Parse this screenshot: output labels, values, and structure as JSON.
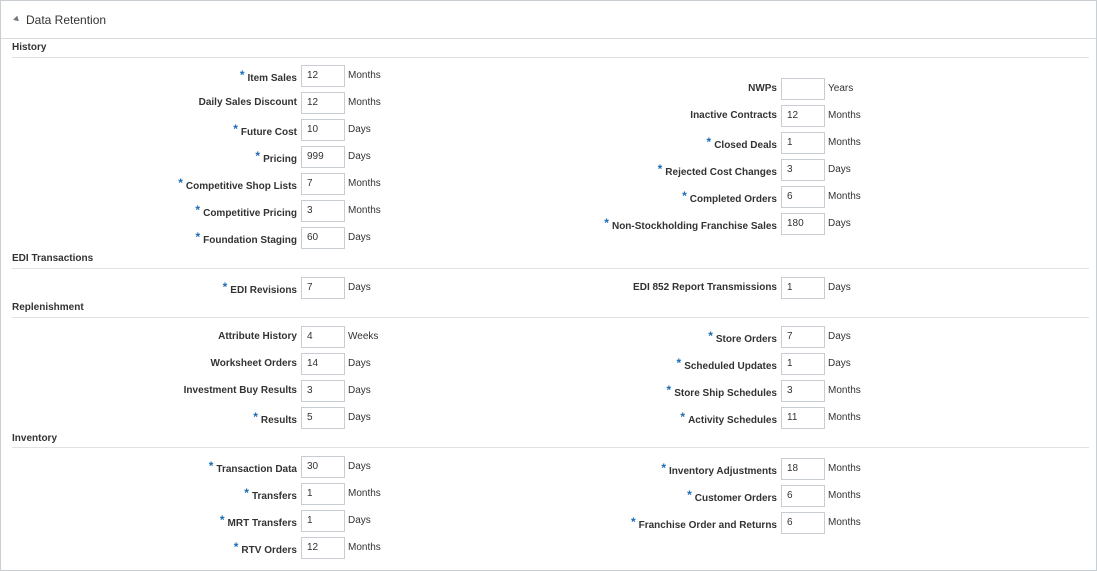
{
  "panel": {
    "title": "Data Retention"
  },
  "sections": {
    "history": "History",
    "edi": "EDI Transactions",
    "replenishment": "Replenishment",
    "inventory": "Inventory"
  },
  "fields": {
    "item_sales": {
      "label": "Item Sales",
      "required": true,
      "value": "12",
      "unit": "Months"
    },
    "daily_sales_discount": {
      "label": "Daily Sales Discount",
      "required": false,
      "value": "12",
      "unit": "Months"
    },
    "future_cost": {
      "label": "Future Cost",
      "required": true,
      "value": "10",
      "unit": "Days"
    },
    "pricing": {
      "label": "Pricing",
      "required": true,
      "value": "999",
      "unit": "Days"
    },
    "competitive_shop_lists": {
      "label": "Competitive Shop Lists",
      "required": true,
      "value": "7",
      "unit": "Months"
    },
    "competitive_pricing": {
      "label": "Competitive Pricing",
      "required": true,
      "value": "3",
      "unit": "Months"
    },
    "foundation_staging": {
      "label": "Foundation Staging",
      "required": true,
      "value": "60",
      "unit": "Days"
    },
    "nwps": {
      "label": "NWPs",
      "required": false,
      "value": "",
      "unit": "Years"
    },
    "inactive_contracts": {
      "label": "Inactive Contracts",
      "required": false,
      "value": "12",
      "unit": "Months"
    },
    "closed_deals": {
      "label": "Closed Deals",
      "required": true,
      "value": "1",
      "unit": "Months"
    },
    "rejected_cost_changes": {
      "label": "Rejected Cost Changes",
      "required": true,
      "value": "3",
      "unit": "Days"
    },
    "completed_orders": {
      "label": "Completed Orders",
      "required": true,
      "value": "6",
      "unit": "Months"
    },
    "non_stockholding_franchise_sales": {
      "label": "Non-Stockholding Franchise Sales",
      "required": true,
      "value": "180",
      "unit": "Days"
    },
    "edi_revisions": {
      "label": "EDI Revisions",
      "required": true,
      "value": "7",
      "unit": "Days"
    },
    "edi_852_report_transmissions": {
      "label": "EDI 852 Report Transmissions",
      "required": false,
      "value": "1",
      "unit": "Days"
    },
    "attribute_history": {
      "label": "Attribute History",
      "required": false,
      "value": "4",
      "unit": "Weeks"
    },
    "worksheet_orders": {
      "label": "Worksheet Orders",
      "required": false,
      "value": "14",
      "unit": "Days"
    },
    "investment_buy_results": {
      "label": "Investment Buy Results",
      "required": false,
      "value": "3",
      "unit": "Days"
    },
    "results": {
      "label": "Results",
      "required": true,
      "value": "5",
      "unit": "Days"
    },
    "store_orders": {
      "label": "Store Orders",
      "required": true,
      "value": "7",
      "unit": "Days"
    },
    "scheduled_updates": {
      "label": "Scheduled Updates",
      "required": true,
      "value": "1",
      "unit": "Days"
    },
    "store_ship_schedules": {
      "label": "Store Ship Schedules",
      "required": true,
      "value": "3",
      "unit": "Months"
    },
    "activity_schedules": {
      "label": "Activity Schedules",
      "required": true,
      "value": "11",
      "unit": "Months"
    },
    "transaction_data": {
      "label": "Transaction Data",
      "required": true,
      "value": "30",
      "unit": "Days"
    },
    "transfers": {
      "label": "Transfers",
      "required": true,
      "value": "1",
      "unit": "Months"
    },
    "mrt_transfers": {
      "label": "MRT Transfers",
      "required": true,
      "value": "1",
      "unit": "Days"
    },
    "rtv_orders": {
      "label": "RTV Orders",
      "required": true,
      "value": "12",
      "unit": "Months"
    },
    "inventory_adjustments": {
      "label": "Inventory Adjustments",
      "required": true,
      "value": "18",
      "unit": "Months"
    },
    "customer_orders": {
      "label": "Customer Orders",
      "required": true,
      "value": "6",
      "unit": "Months"
    },
    "franchise_order_and_returns": {
      "label": "Franchise Order and Returns",
      "required": true,
      "value": "6",
      "unit": "Months"
    }
  },
  "colors": {
    "required_marker": "#1c6cb4",
    "border": "#c7cdd2",
    "rule": "#dfe3e6"
  }
}
